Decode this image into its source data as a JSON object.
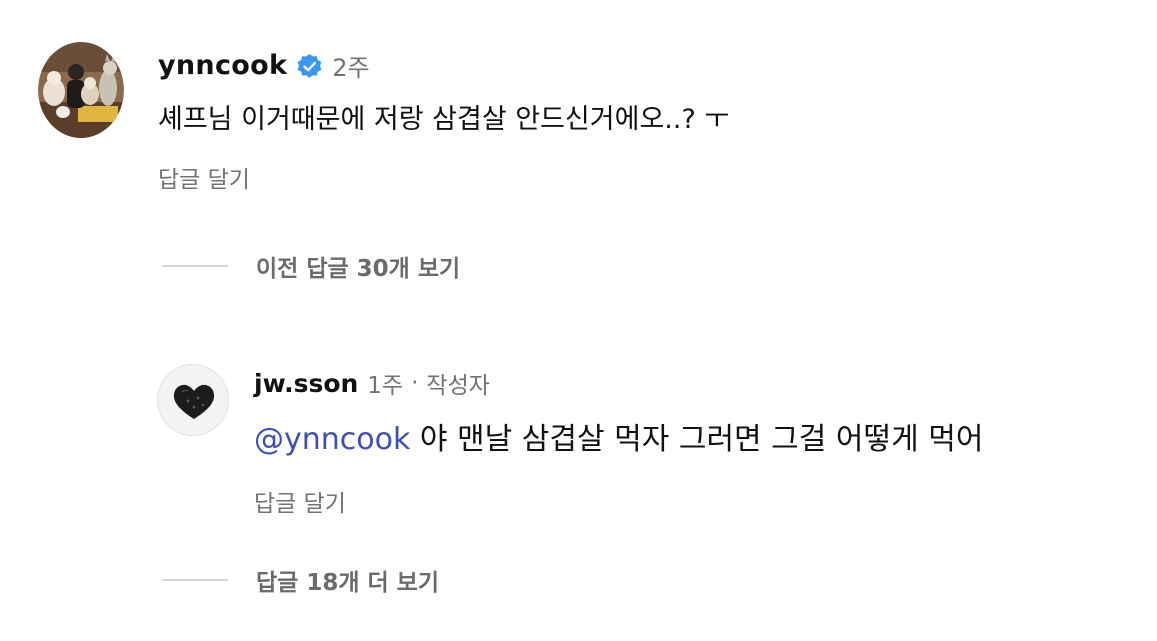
{
  "comment": {
    "username": "ynncook",
    "verified": true,
    "time": "2주",
    "text": "셰프님 이거때문에 저랑 삼겹살 안드신거에오..? ㅜ",
    "reply_link": "답글 달기",
    "avatar_icon": "profile-photo-with-dogs"
  },
  "previous_replies": {
    "label": "이전 답글 30개 보기"
  },
  "reply": {
    "username": "jw.sson",
    "time": "1주",
    "separator": "·",
    "author_tag": "작성자",
    "mention": "@ynncook",
    "text": " 야 맨날 삼겹살 먹자 그러면 그걸 어떻게 먹어",
    "reply_link": "답글 달기",
    "avatar_icon": "black-heart-avatar"
  },
  "more_replies": {
    "label": "답글 18개 더 보기"
  },
  "colors": {
    "verified_badge": "#3897f0",
    "mention": "#3f4fb8",
    "secondary_text": "#737373",
    "divider": "#d6d6d6"
  }
}
